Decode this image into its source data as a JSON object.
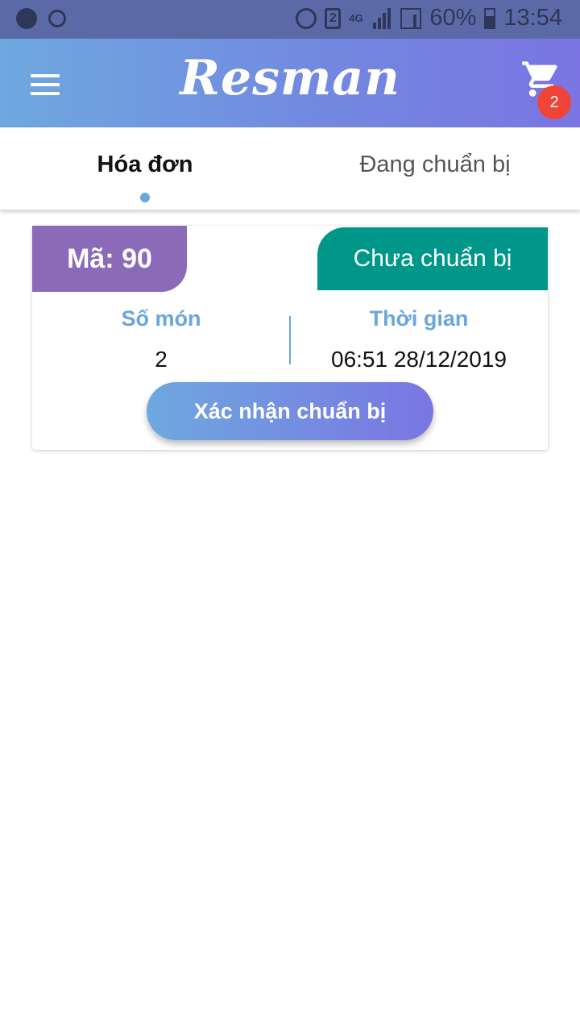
{
  "status_bar": {
    "battery": "60%",
    "time": "13:54",
    "sim_slot": "2",
    "network": "4G",
    "icons": [
      "app-notification-icon",
      "alarm-icon",
      "alarm-icon",
      "sim-icon",
      "signal-icon",
      "battery-icon"
    ]
  },
  "header": {
    "app_name": "Resman",
    "cart_count": "2"
  },
  "tabs": [
    {
      "label": "Hóa đơn",
      "active": true
    },
    {
      "label": "Đang chuẩn bị",
      "active": false
    }
  ],
  "order_card": {
    "code_label": "Mã: 90",
    "status": "Chưa chuẩn bị",
    "items_label": "Số món",
    "items_value": "2",
    "time_label": "Thời gian",
    "time_value": "06:51 28/12/2019",
    "confirm_label": "Xác nhận chuẩn bị"
  },
  "colors": {
    "header_gradient_start": "#6ea8df",
    "header_gradient_end": "#7a75e2",
    "code_badge": "#8a6ab9",
    "status_tag": "#00978a",
    "badge_red": "#f04437",
    "accent_blue": "#6ba6dc"
  }
}
